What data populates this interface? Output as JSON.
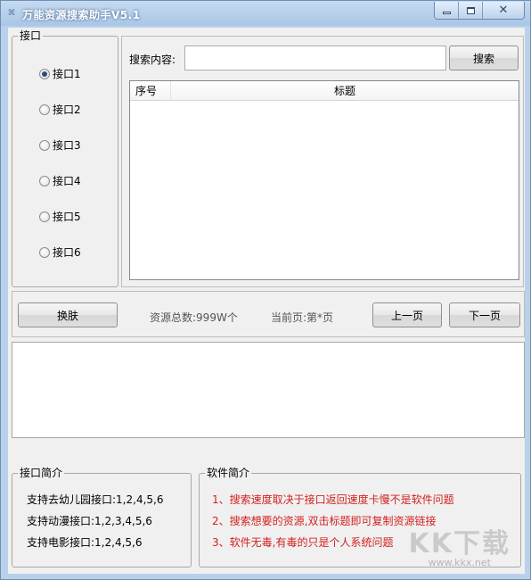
{
  "window": {
    "title": "万能资源搜索助手V5.1",
    "controls": {
      "minimize": "▭",
      "maximize": "□",
      "close": "✕"
    }
  },
  "interfaces": {
    "legend": "接口",
    "options": [
      "接口1",
      "接口2",
      "接口3",
      "接口4",
      "接口5",
      "接口6"
    ],
    "selected": 0
  },
  "search": {
    "label": "搜索内容:",
    "value": "",
    "button": "搜索"
  },
  "results": {
    "columns": [
      "序号",
      "标题"
    ],
    "rows": []
  },
  "toolbar": {
    "skin_button": "换肤",
    "total_text": "资源总数:999W个",
    "current_page_text": "当前页:第*页",
    "prev_button": "上一页",
    "next_button": "下一页"
  },
  "interface_intro": {
    "legend": "接口简介",
    "lines": [
      "支持去幼儿园接口:1,2,4,5,6",
      "支持动漫接口:1,2,3,4,5,6",
      "支持电影接口:1,2,4,5,6"
    ]
  },
  "software_intro": {
    "legend": "软件简介",
    "lines": [
      "1、搜索速度取决于接口返回速度卡慢不是软件问题",
      "2、搜索想要的资源,双击标题即可复制资源链接",
      "3、软件无毒,有毒的只是个人系统问题"
    ]
  },
  "watermark": {
    "big": "KK下载",
    "small": "www.kkx.net"
  }
}
